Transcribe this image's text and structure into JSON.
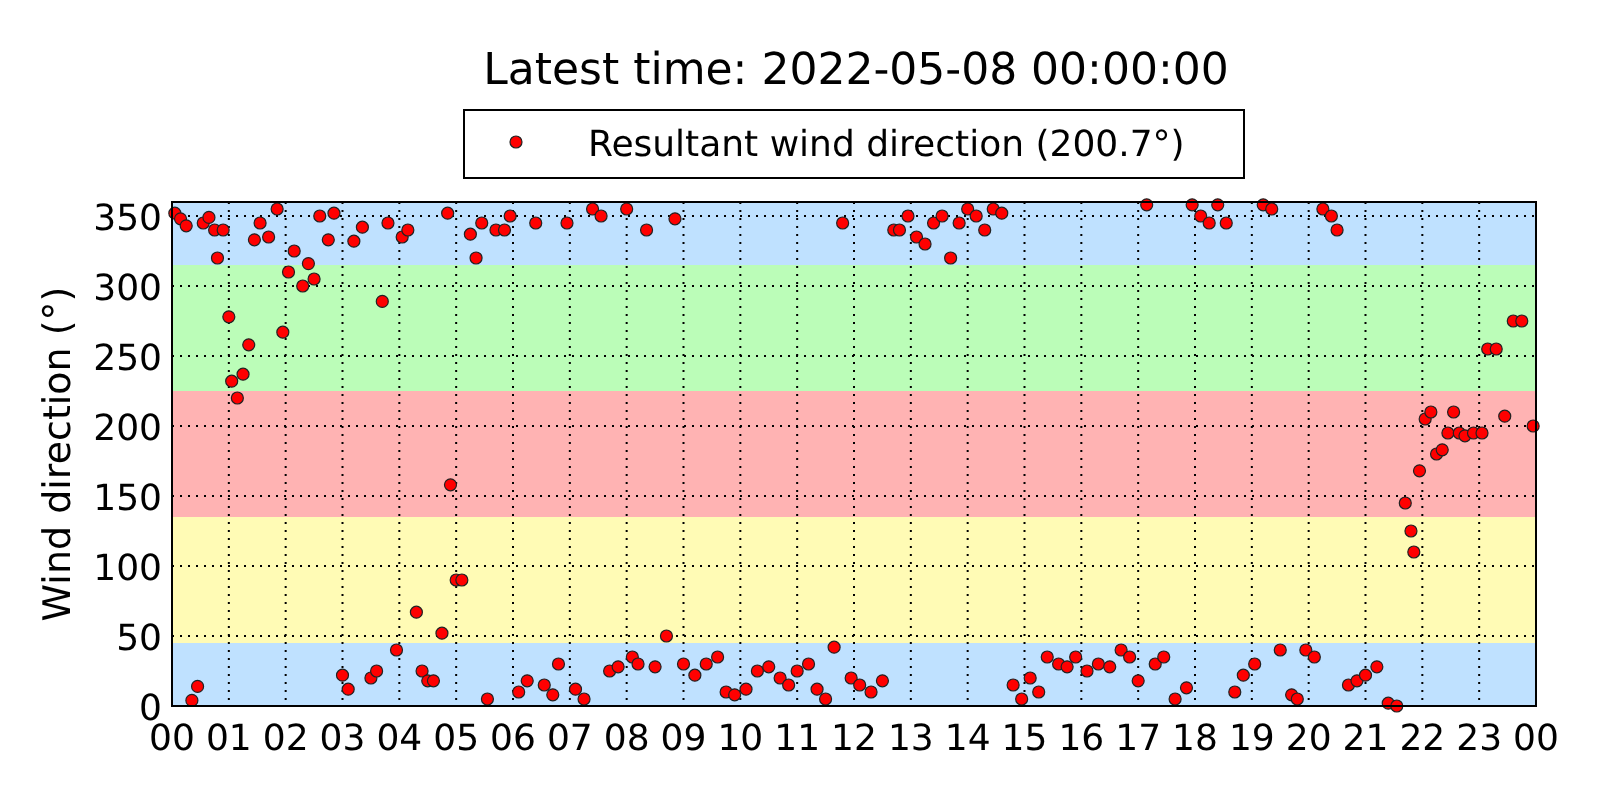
{
  "chart": {
    "chart_data": {
      "type": "scatter",
      "title": "Latest time: 2022-05-08 00:00:00",
      "ylabel": "Wind direction (°)",
      "xlim": [
        0,
        24
      ],
      "ylim": [
        0,
        360
      ],
      "xticks": [
        {
          "value": 0,
          "label": "00"
        },
        {
          "value": 1,
          "label": "01"
        },
        {
          "value": 2,
          "label": "02"
        },
        {
          "value": 3,
          "label": "03"
        },
        {
          "value": 4,
          "label": "04"
        },
        {
          "value": 5,
          "label": "05"
        },
        {
          "value": 6,
          "label": "06"
        },
        {
          "value": 7,
          "label": "07"
        },
        {
          "value": 8,
          "label": "08"
        },
        {
          "value": 9,
          "label": "09"
        },
        {
          "value": 10,
          "label": "10"
        },
        {
          "value": 11,
          "label": "11"
        },
        {
          "value": 12,
          "label": "12"
        },
        {
          "value": 13,
          "label": "13"
        },
        {
          "value": 14,
          "label": "14"
        },
        {
          "value": 15,
          "label": "15"
        },
        {
          "value": 16,
          "label": "16"
        },
        {
          "value": 17,
          "label": "17"
        },
        {
          "value": 18,
          "label": "18"
        },
        {
          "value": 19,
          "label": "19"
        },
        {
          "value": 20,
          "label": "20"
        },
        {
          "value": 21,
          "label": "21"
        },
        {
          "value": 22,
          "label": "22"
        },
        {
          "value": 23,
          "label": "23"
        },
        {
          "value": 24,
          "label": "00"
        }
      ],
      "yticks": [
        0,
        50,
        100,
        150,
        200,
        250,
        300,
        350
      ],
      "grid": true,
      "bands": [
        {
          "axis": "y",
          "from": 0,
          "to": 45,
          "color": "#bfe1ff"
        },
        {
          "axis": "y",
          "from": 45,
          "to": 135,
          "color": "#fffbb5"
        },
        {
          "axis": "y",
          "from": 135,
          "to": 225,
          "color": "#ffb3b3"
        },
        {
          "axis": "y",
          "from": 225,
          "to": 315,
          "color": "#bbfdb8"
        },
        {
          "axis": "y",
          "from": 315,
          "to": 360,
          "color": "#bfe1ff"
        }
      ],
      "x": [
        0.05,
        0.15,
        0.25,
        0.35,
        0.45,
        0.55,
        0.65,
        0.75,
        0.8,
        0.9,
        1.0,
        1.05,
        1.15,
        1.25,
        1.35,
        1.45,
        1.55,
        1.7,
        1.85,
        1.95,
        2.05,
        2.15,
        2.3,
        2.4,
        2.5,
        2.6,
        2.75,
        2.85,
        3.0,
        3.1,
        3.2,
        3.35,
        3.5,
        3.6,
        3.7,
        3.8,
        3.95,
        4.05,
        4.15,
        4.3,
        4.4,
        4.5,
        4.6,
        4.75,
        4.85,
        4.9,
        5.0,
        5.1,
        5.25,
        5.35,
        5.45,
        5.55,
        5.7,
        5.85,
        5.95,
        6.1,
        6.25,
        6.4,
        6.55,
        6.7,
        6.8,
        6.95,
        7.1,
        7.25,
        7.4,
        7.55,
        7.7,
        7.85,
        8.0,
        8.1,
        8.2,
        8.35,
        8.5,
        8.7,
        8.85,
        9.0,
        9.2,
        9.4,
        9.6,
        9.75,
        9.9,
        10.1,
        10.3,
        10.5,
        10.7,
        10.85,
        11.0,
        11.2,
        11.35,
        11.5,
        11.65,
        11.8,
        11.95,
        12.1,
        12.3,
        12.5,
        12.7,
        12.8,
        12.95,
        13.1,
        13.25,
        13.4,
        13.55,
        13.7,
        13.85,
        14.0,
        14.15,
        14.3,
        14.45,
        14.6,
        14.8,
        14.95,
        15.1,
        15.25,
        15.4,
        15.6,
        15.75,
        15.9,
        16.1,
        16.3,
        16.5,
        16.7,
        16.85,
        17.0,
        17.15,
        17.3,
        17.45,
        17.65,
        17.85,
        17.95,
        18.1,
        18.25,
        18.4,
        18.55,
        18.7,
        18.85,
        19.05,
        19.2,
        19.35,
        19.5,
        19.7,
        19.8,
        19.95,
        20.1,
        20.25,
        20.4,
        20.5,
        20.7,
        20.85,
        21.0,
        21.2,
        21.4,
        21.55,
        21.7,
        21.8,
        21.85,
        21.95,
        22.05,
        22.15,
        22.25,
        22.35,
        22.45,
        22.55,
        22.65,
        22.75,
        22.9,
        23.05,
        23.15,
        23.3,
        23.45,
        23.6,
        23.75,
        23.95
      ],
      "series": [
        {
          "name": "Resultant wind direction (200.7°)",
          "color": "#ff0000",
          "values": [
            352,
            348,
            343,
            4,
            14,
            345,
            349,
            340,
            320,
            340,
            278,
            232,
            220,
            237,
            258,
            333,
            345,
            335,
            355,
            267,
            310,
            325,
            300,
            316,
            305,
            350,
            333,
            352,
            22,
            12,
            332,
            342,
            20,
            25,
            289,
            345,
            40,
            335,
            340,
            67,
            25,
            18,
            18,
            52,
            352,
            158,
            90,
            90,
            337,
            320,
            345,
            5,
            340,
            340,
            350,
            10,
            18,
            345,
            15,
            8,
            30,
            345,
            12,
            5,
            355,
            350,
            25,
            28,
            355,
            35,
            30,
            340,
            28,
            50,
            348,
            30,
            22,
            30,
            35,
            10,
            8,
            12,
            25,
            28,
            20,
            15,
            25,
            30,
            12,
            5,
            42,
            345,
            20,
            15,
            10,
            18,
            340,
            340,
            350,
            335,
            330,
            345,
            350,
            320,
            345,
            355,
            350,
            340,
            355,
            352,
            15,
            5,
            20,
            10,
            35,
            30,
            28,
            35,
            25,
            30,
            28,
            40,
            35,
            18,
            358,
            30,
            35,
            5,
            13,
            358,
            350,
            345,
            358,
            345,
            10,
            22,
            30,
            358,
            355,
            40,
            8,
            5,
            40,
            35,
            355,
            350,
            340,
            15,
            18,
            22,
            28,
            2,
            0,
            145,
            125,
            110,
            168,
            205,
            210,
            180,
            183,
            195,
            210,
            195,
            193,
            195,
            195,
            255,
            255,
            207,
            275,
            275,
            200
          ]
        }
      ]
    }
  }
}
